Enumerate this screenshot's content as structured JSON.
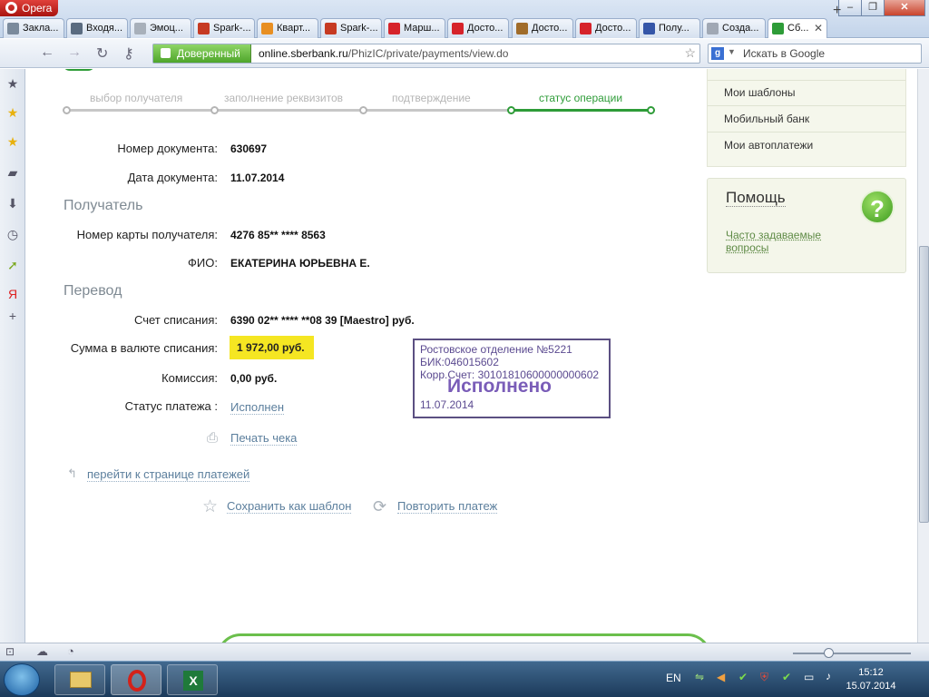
{
  "browser": {
    "app_name": "Opera",
    "tabs": [
      {
        "label": "Закла...",
        "color": "#7a8a9c"
      },
      {
        "label": "Входя...",
        "color": "#5a6b80"
      },
      {
        "label": "Эмоц...",
        "color": "#a8b0ba"
      },
      {
        "label": "Spark-...",
        "color": "#c63a22"
      },
      {
        "label": "Кварт...",
        "color": "#e88f22"
      },
      {
        "label": "Spark-...",
        "color": "#c63a22"
      },
      {
        "label": "Марш...",
        "color": "#d6232a"
      },
      {
        "label": "Досто...",
        "color": "#d6232a"
      },
      {
        "label": "Досто...",
        "color": "#a06c2a"
      },
      {
        "label": "Досто...",
        "color": "#d6232a"
      },
      {
        "label": "Полу...",
        "color": "#3556a8"
      },
      {
        "label": "Созда...",
        "color": "#a0a8b4"
      },
      {
        "label": "Сб...",
        "color": "#2e9c38"
      }
    ],
    "trusted_label": "Доверенный",
    "url_host": "online.sberbank.ru",
    "url_path": "/PhizIC/private/payments/view.do",
    "search_placeholder": "Искать в Google",
    "search_engine": "g",
    "min_glyph": "–",
    "restore_glyph": "❐",
    "close_glyph": "✕",
    "newtab_glyph": "+"
  },
  "steps": [
    {
      "label": "выбор получателя"
    },
    {
      "label": "заполнение реквизитов"
    },
    {
      "label": "подтверждение"
    },
    {
      "label": "статус операции"
    }
  ],
  "document": {
    "number_label": "Номер документа:",
    "number_value": "630697",
    "date_label": "Дата документа:",
    "date_value": "11.07.2014"
  },
  "recipient": {
    "section_title": "Получатель",
    "card_label": "Номер карты получателя:",
    "card_value": "4276 85** **** 8563",
    "name_label": "ФИО:",
    "name_value": "ЕКАТЕРИНА ЮРЬЕВНА Е."
  },
  "transfer": {
    "section_title": "Перевод",
    "account_label": "Счет списания:",
    "account_value": "6390 02** **** **08 39  [Maestro]  руб.",
    "amount_label": "Сумма в валюте списания:",
    "amount_value": "1 972,00  руб.",
    "fee_label": "Комиссия:",
    "fee_value": "0,00 руб.",
    "status_label": "Статус платежа :",
    "status_value": "Исполнен"
  },
  "stamp": {
    "line1": "Ростовское отделение №5221",
    "line2": "БИК:046015602",
    "line3": "Корр.Счет: 30101810600000000602",
    "status": "Исполнено",
    "date": "11.07.2014"
  },
  "actions": {
    "print": "Печать чека",
    "back": "перейти к странице платежей",
    "save_template": "Сохранить как шаблон",
    "repeat": "Повторить платеж"
  },
  "right_menu": {
    "items": [
      "Мои шаблоны",
      "Мобильный банк",
      "Мои автоплатежи"
    ]
  },
  "help": {
    "title": "Помощь",
    "faq": "Часто задаваемые вопросы",
    "q_glyph": "?"
  },
  "taskbar": {
    "lang": "EN",
    "time": "15:12",
    "date": "15.07.2014"
  }
}
